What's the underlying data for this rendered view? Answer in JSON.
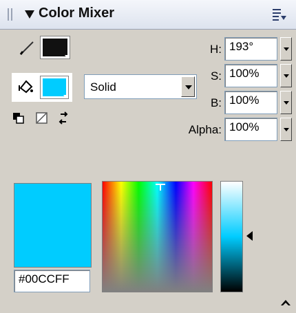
{
  "panel": {
    "title": "Color Mixer"
  },
  "colors": {
    "stroke": "#111111",
    "fill": "#00CCFF",
    "spectrum_bg": "#d4d0c8"
  },
  "icons": {
    "grip": "grip-icon",
    "collapse": "collapse-triangle-icon",
    "menu": "options-menu-icon",
    "stroke": "pencil-icon",
    "fill": "paint-bucket-icon",
    "default_colors": "default-colors-icon",
    "no_color": "no-color-icon",
    "swap_colors": "swap-colors-icon"
  },
  "fill_type": {
    "selected": "Solid"
  },
  "hsb": {
    "h_label": "H:",
    "h_value": "193°",
    "s_label": "S:",
    "s_value": "100%",
    "b_label": "B:",
    "b_value": "100%",
    "alpha_label": "Alpha:",
    "alpha_value": "100%"
  },
  "hex": {
    "value": "#00CCFF"
  }
}
